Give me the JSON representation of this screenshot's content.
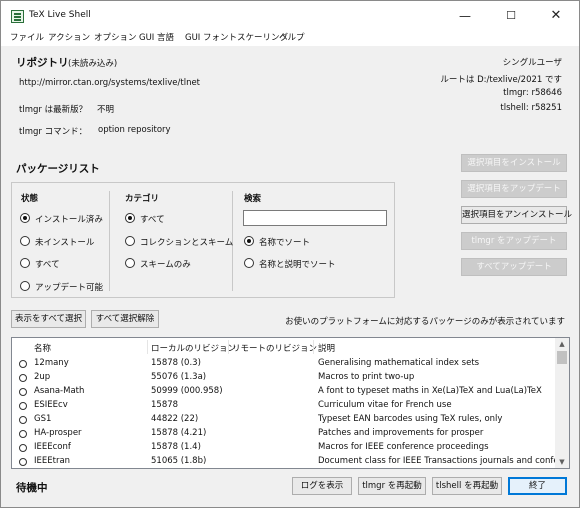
{
  "window": {
    "title": "TeX Live Shell",
    "controls": {
      "minimize": "—",
      "maximize": "☐",
      "close": "✕"
    }
  },
  "menu": {
    "file": "ファイル",
    "action": "アクション",
    "options": "オプション",
    "gui_language": "GUI 言語",
    "gui_font_scaling": "GUI フォントスケーリング",
    "help": "ヘルプ"
  },
  "repository": {
    "title": "リポジトリ",
    "status": "(未読み込み)",
    "url": "http://mirror.ctan.org/systems/texlive/tlnet",
    "tlmgr_latest_label": "tlmgr は最新版？",
    "tlmgr_latest_value": "不明",
    "tlmgr_command_label": "tlmgr コマンド：",
    "tlmgr_command_value": "option repository"
  },
  "info": {
    "user_mode": "シングルユーザ",
    "root": "ルートは D:/texlive/2021 です",
    "tlmgr_rev": "tlmgr: r58646",
    "tlshell_rev": "tlshell: r58251"
  },
  "packages": {
    "title": "パッケージリスト",
    "status_group": {
      "title": "状態",
      "options": [
        "インストール済み",
        "未インストール",
        "すべて",
        "アップデート可能"
      ]
    },
    "category_group": {
      "title": "カテゴリ",
      "options": [
        "すべて",
        "コレクションとスキーム",
        "スキームのみ"
      ]
    },
    "search_group": {
      "title": "検索",
      "value": "",
      "options": [
        "名称でソート",
        "名称と説明でソート"
      ]
    },
    "select_all": "表示をすべて選択",
    "deselect_all": "すべて選択解除",
    "platform_note": "お使いのプラットフォームに対応するパッケージのみが表示されています",
    "columns": [
      "名称",
      "ローカルのリビジョン",
      "リモートのリビジョン",
      "説明"
    ],
    "rows": [
      {
        "name": "12many",
        "local": "15878 (0.3)",
        "remote": "",
        "desc": "Generalising mathematical index sets"
      },
      {
        "name": "2up",
        "local": "55076 (1.3a)",
        "remote": "",
        "desc": "Macros to print two-up"
      },
      {
        "name": "Asana-Math",
        "local": "50999 (000.958)",
        "remote": "",
        "desc": "A font to typeset maths in Xe(La)TeX and Lua(La)TeX"
      },
      {
        "name": "ESIEEcv",
        "local": "15878",
        "remote": "",
        "desc": "Curriculum vitae for French use"
      },
      {
        "name": "GS1",
        "local": "44822 (22)",
        "remote": "",
        "desc": "Typeset EAN barcodes using TeX rules, only"
      },
      {
        "name": "HA-prosper",
        "local": "15878 (4.21)",
        "remote": "",
        "desc": "Patches and improvements for prosper"
      },
      {
        "name": "IEEEconf",
        "local": "15878 (1.4)",
        "remote": "",
        "desc": "Macros for IEEE conference proceedings"
      },
      {
        "name": "IEEEtran",
        "local": "51065 (1.8b)",
        "remote": "",
        "desc": "Document class for IEEE Transactions journals and confe"
      }
    ]
  },
  "actions": {
    "install_selected": "選択項目をインストール",
    "update_selected": "選択項目をアップデート",
    "uninstall_selected": "選択項目をアンインストール",
    "update_tlmgr": "tlmgr をアップデート",
    "update_all": "すべてアップデート"
  },
  "footer": {
    "status": "待機中",
    "show_log": "ログを表示",
    "restart_tlmgr": "tlmgr を再起動",
    "restart_tlshell": "tlshell を再起動",
    "quit": "終了"
  }
}
